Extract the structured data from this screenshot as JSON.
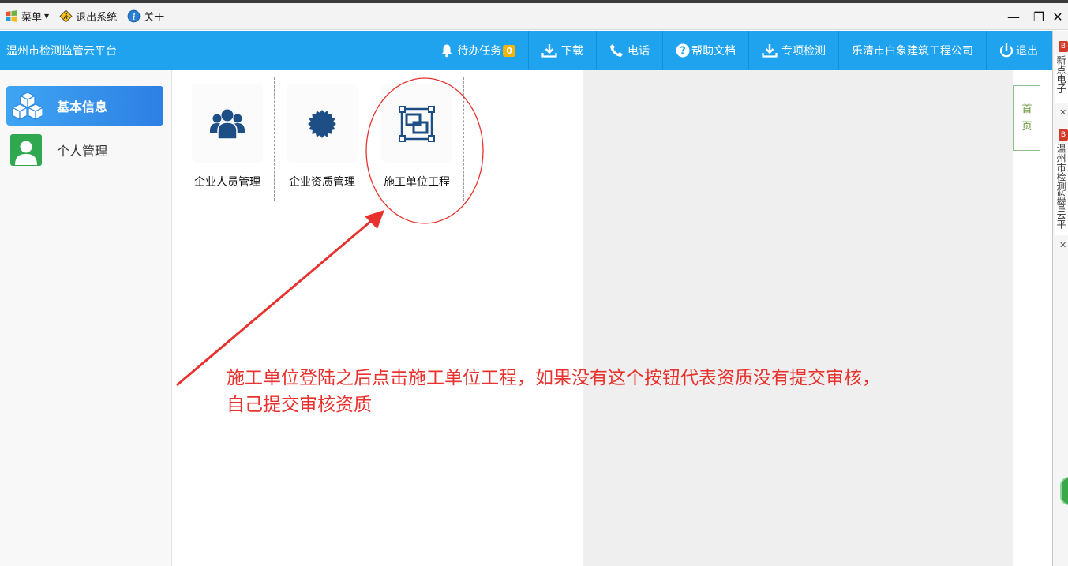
{
  "window": {
    "menu_label": "菜单",
    "exit_label": "退出系统",
    "about_label": "关于",
    "minimize_glyph": "—",
    "restore_glyph": "❐",
    "close_glyph": "✕"
  },
  "header": {
    "title": "温州市检测监管云平台",
    "todo_label": "待办任务",
    "todo_count": "0",
    "download_label": "下载",
    "phone_label": "电话",
    "help_label": "帮助文档",
    "special_label": "专项检测",
    "company_label": "乐清市白象建筑工程公司",
    "logout_label": "退出"
  },
  "sidebar": {
    "items": [
      {
        "label": "基本信息",
        "icon": "cubes-icon",
        "active": true
      },
      {
        "label": "个人管理",
        "icon": "user-icon",
        "active": false
      }
    ]
  },
  "tiles": [
    {
      "label": "企业人员管理",
      "icon": "users-icon"
    },
    {
      "label": "企业资质管理",
      "icon": "certificate-icon"
    },
    {
      "label": "施工单位工程",
      "icon": "project-icon"
    }
  ],
  "annotation": {
    "line1": "施工单位登陆之后点击施工单位工程，如果没有这个按钮代表资质没有提交审核，",
    "line2": "自己提交审核资质"
  },
  "home_tab": {
    "char1": "首",
    "char2": "页"
  },
  "right_rail": {
    "tab1": "新点电子",
    "tab2": "温州市检测监管云平",
    "badge": "B",
    "close": "✕"
  },
  "colors": {
    "header_bg": "#1fa3ee",
    "sidebar_active": "#3ea5f2",
    "tile_icon": "#1e4e86",
    "annotation": "#e8322e"
  }
}
